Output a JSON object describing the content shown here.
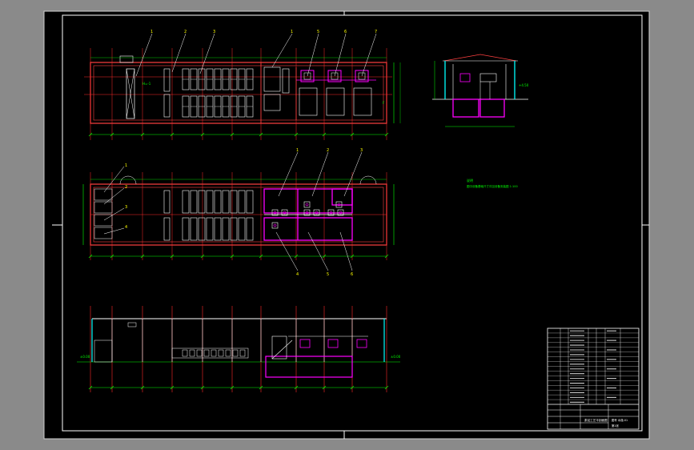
{
  "viewport": {
    "background": "#8a8a8a",
    "sheet_color": "#000000",
    "frame_color": "#ffffff"
  },
  "colors": {
    "wall": "#ff4040",
    "grid": "#ff2a2a",
    "equipment": "#ffffff",
    "highlight": "#ff00ff",
    "dimension": "#00ff00",
    "water": "#00ffff",
    "label": "#ffff00"
  },
  "drawing": {
    "plan_top": {
      "callouts": [
        "1",
        "2",
        "3",
        "1",
        "5",
        "6",
        "7"
      ]
    },
    "plan_middle": {
      "callouts_left": [
        "1",
        "2",
        "3",
        "4"
      ],
      "callouts_top": [
        "1",
        "2",
        "3"
      ],
      "callouts_bottom": [
        "4",
        "5",
        "6"
      ]
    },
    "section_right": {
      "annotation": "说明",
      "note": "图中设备基础尺寸详见设备安装图 1:100"
    }
  },
  "title_block": {
    "rows": 16,
    "project_title": "泵站工艺平剖面图",
    "drawing_number": "图号 水施-01",
    "sheet": "第1张"
  }
}
